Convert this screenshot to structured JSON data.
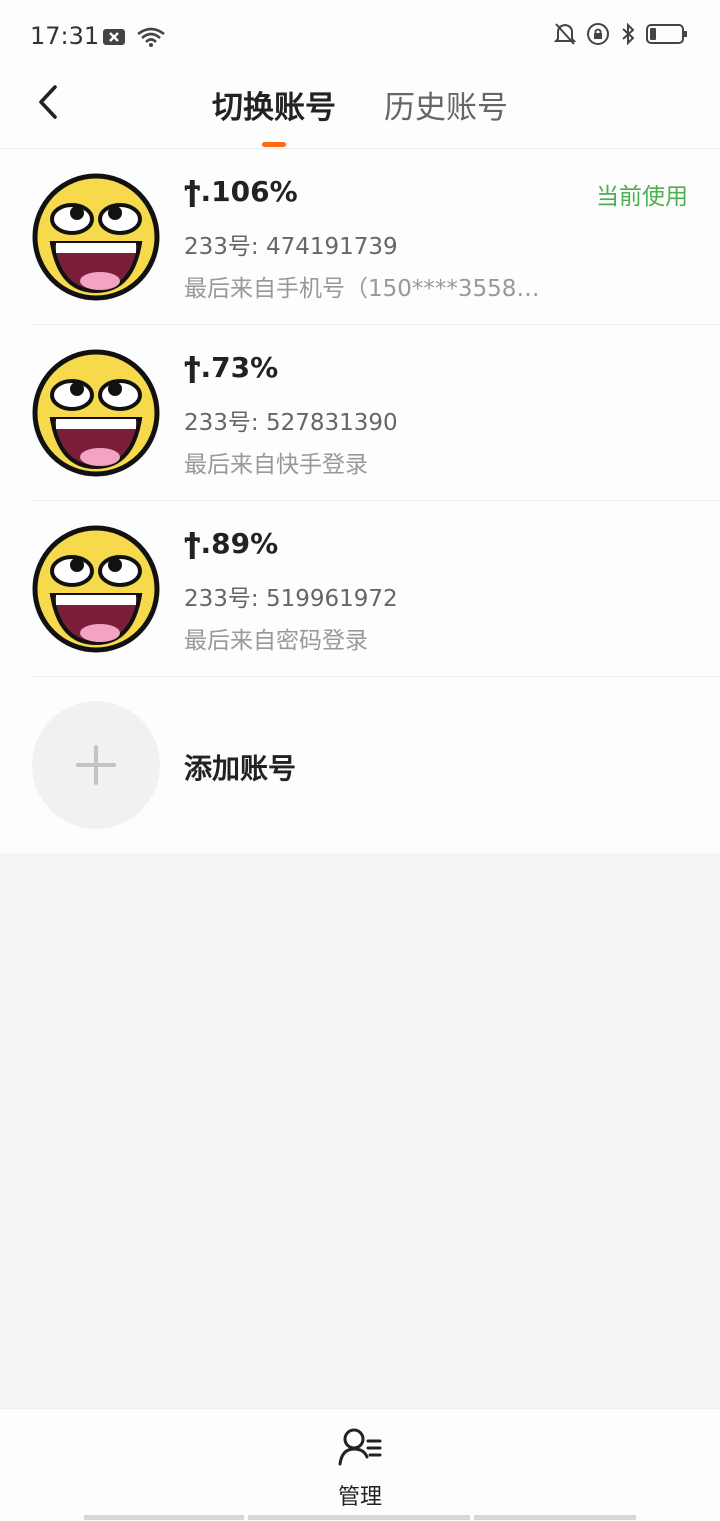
{
  "status_bar": {
    "time": "17:31",
    "left_icons": [
      "notification-x-icon",
      "wifi-icon"
    ],
    "right_icons": [
      "mute-bell-icon",
      "rotation-lock-icon",
      "bluetooth-icon",
      "battery-icon"
    ]
  },
  "header": {
    "back_icon": "chevron-left-icon",
    "tabs": [
      {
        "label": "切换账号",
        "active": true
      },
      {
        "label": "历史账号",
        "active": false
      }
    ],
    "indicator_color": "#ff6a10"
  },
  "accounts": [
    {
      "name": "ϯ.106%",
      "id": "233号: 474191739",
      "login": "最后来自手机号（150****3558）…",
      "badge": "当前使用"
    },
    {
      "name": "ϯ.73%",
      "id": "233号: 527831390",
      "login": "最后来自快手登录"
    },
    {
      "name": "ϯ.89%",
      "id": "233号: 519961972",
      "login": "最后来自密码登录"
    }
  ],
  "add_account": {
    "label": "添加账号",
    "icon": "plus-icon"
  },
  "bottom_bar": {
    "manage_label": "管理",
    "icon": "user-manage-icon"
  },
  "colors": {
    "accent": "#ff6a10",
    "current_badge": "#4caf50"
  }
}
